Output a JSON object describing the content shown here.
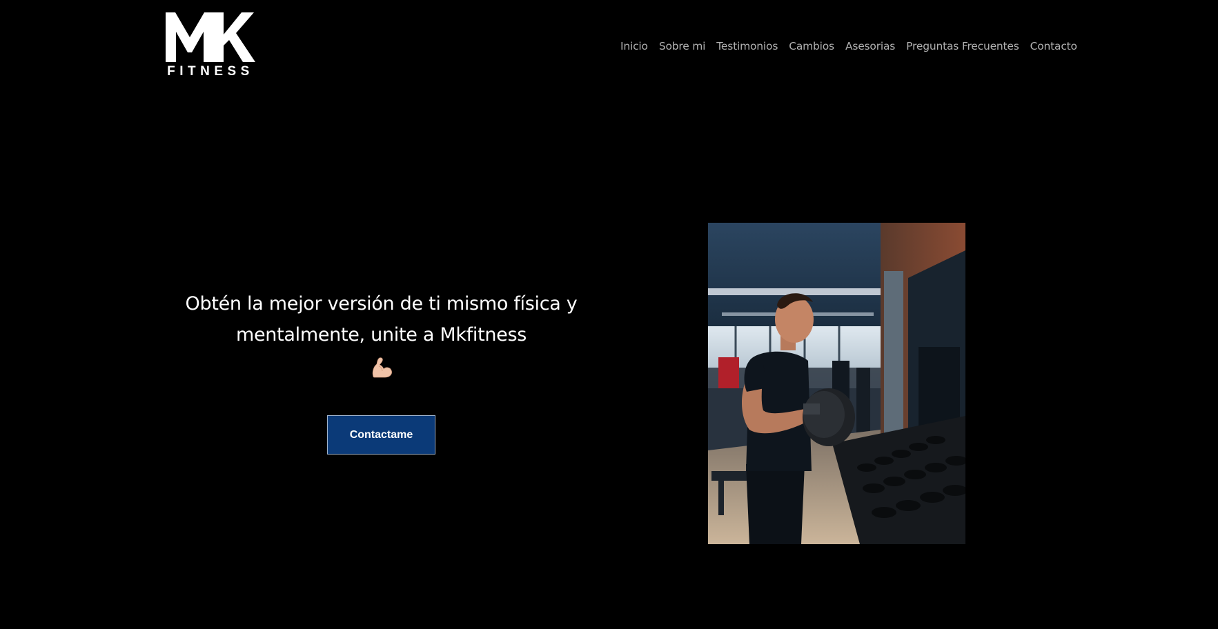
{
  "brand": {
    "logo_letters": "MK",
    "logo_word": "FITNESS"
  },
  "nav": {
    "items": [
      {
        "label": "Inicio"
      },
      {
        "label": "Sobre mi"
      },
      {
        "label": "Testimonios"
      },
      {
        "label": "Cambios"
      },
      {
        "label": "Asesorias"
      },
      {
        "label": "Preguntas Frecuentes"
      },
      {
        "label": "Contacto"
      }
    ]
  },
  "hero": {
    "headline_line1": "Obtén la mejor versión de ti mismo física y",
    "headline_line2": "mentalmente, unite a Mkfitness",
    "emoji": "flexed-biceps-icon",
    "cta_label": "Contactame",
    "cta_color": "#0b3a78",
    "image_subject": "man-lifting-dumbbell-in-gym"
  },
  "colors": {
    "background": "#000000",
    "nav_text": "#b0b0b0",
    "text": "#ffffff"
  }
}
